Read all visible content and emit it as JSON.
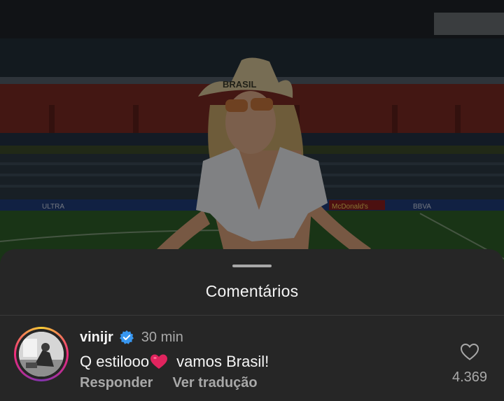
{
  "sheet": {
    "title": "Comentários"
  },
  "comment": {
    "username": "vinijr",
    "time": "30 min",
    "text_before": "Q estilooo",
    "text_emoji": "red-heart-emoji",
    "text_after": " vamos Brasil!",
    "actions": {
      "reply": "Responder",
      "translate": "Ver tradução"
    },
    "like_count": "4.369"
  },
  "photo": {
    "hat_text": "BRASIL",
    "banners": [
      "ULTRA",
      "McDonald's",
      "BBVA"
    ]
  },
  "icons": {
    "verified": "verified-badge-icon",
    "like": "heart-outline-icon"
  },
  "colors": {
    "sheet_bg": "#262626",
    "verified_blue": "#3897f0",
    "heart_red": "#e0245e",
    "pitch_green": "#2f6a2a",
    "seats_red": "#a52a22"
  }
}
